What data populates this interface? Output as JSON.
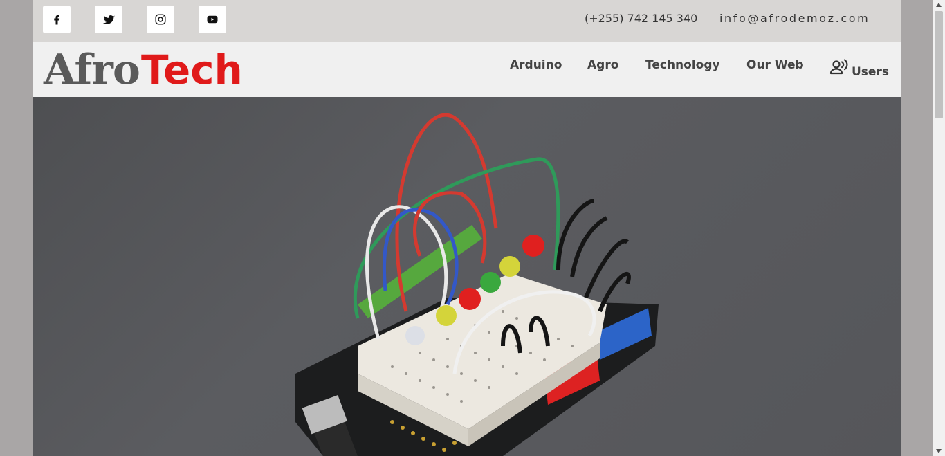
{
  "topbar": {
    "social": [
      {
        "name": "facebook-icon"
      },
      {
        "name": "twitter-icon"
      },
      {
        "name": "instagram-icon"
      },
      {
        "name": "youtube-icon"
      }
    ],
    "phone": "(+255) 742 145 340",
    "email": "info@afrodemoz.com"
  },
  "logo": {
    "part1": "Afro",
    "part2": "Tech"
  },
  "nav": {
    "items": [
      "Arduino",
      "Agro",
      "Technology",
      "Our Web"
    ],
    "users_label": "Users"
  },
  "colors": {
    "brand_red": "#e01a1a",
    "logo_gray": "#5a5a5a",
    "topbar_bg": "#d8d6d4",
    "navbar_bg": "#f0f0f0"
  }
}
